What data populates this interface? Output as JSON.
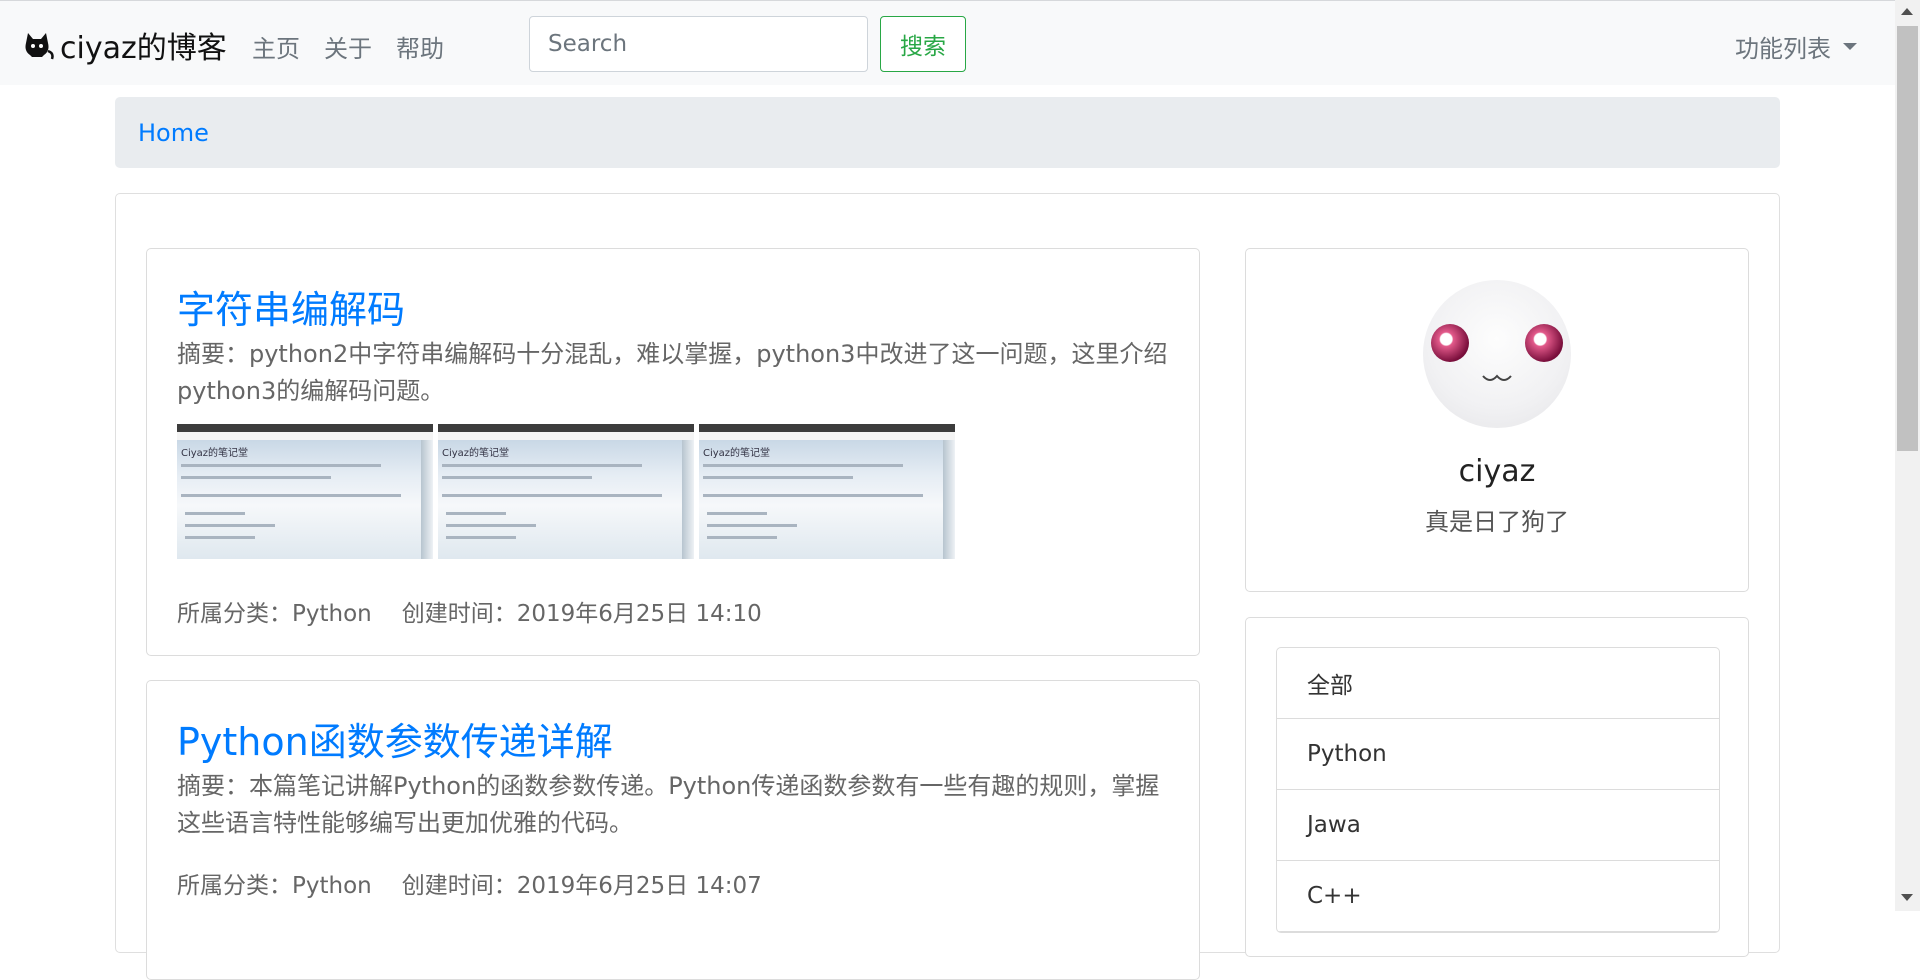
{
  "navbar": {
    "brand": "ciyaz的博客",
    "brand_icon": "cat-icon",
    "links": [
      "主页",
      "关于",
      "帮助"
    ],
    "search_placeholder": "Search",
    "search_button": "搜索",
    "dropdown_label": "功能列表"
  },
  "breadcrumb": {
    "home": "Home"
  },
  "posts": [
    {
      "title": "字符串编解码",
      "summary": "摘要：python2中字符串编解码十分混乱，难以掌握，python3中改进了这一问题，这里介绍python3的编解码问题。",
      "thumbnail_caption": "Ciyaz的笔记堂",
      "category": "所属分类：Python",
      "created": "创建时间：2019年6月25日 14:10"
    },
    {
      "title": "Python函数参数传递详解",
      "summary": "摘要：本篇笔记讲解Python的函数参数传递。Python传递函数参数有一些有趣的规则，掌握这些语言特性能够编写出更加优雅的代码。",
      "category": "所属分类：Python",
      "created": "创建时间：2019年6月25日 14:07"
    }
  ],
  "profile": {
    "name": "ciyaz",
    "motto": "真是日了狗了"
  },
  "categories": [
    "全部",
    "Python",
    "Jawa",
    "C++"
  ],
  "colors": {
    "link": "#007bff",
    "success": "#28a745",
    "muted": "#6c757d",
    "breadcrumb_bg": "#e9ecef",
    "navbar_bg": "#f8f9fa"
  }
}
